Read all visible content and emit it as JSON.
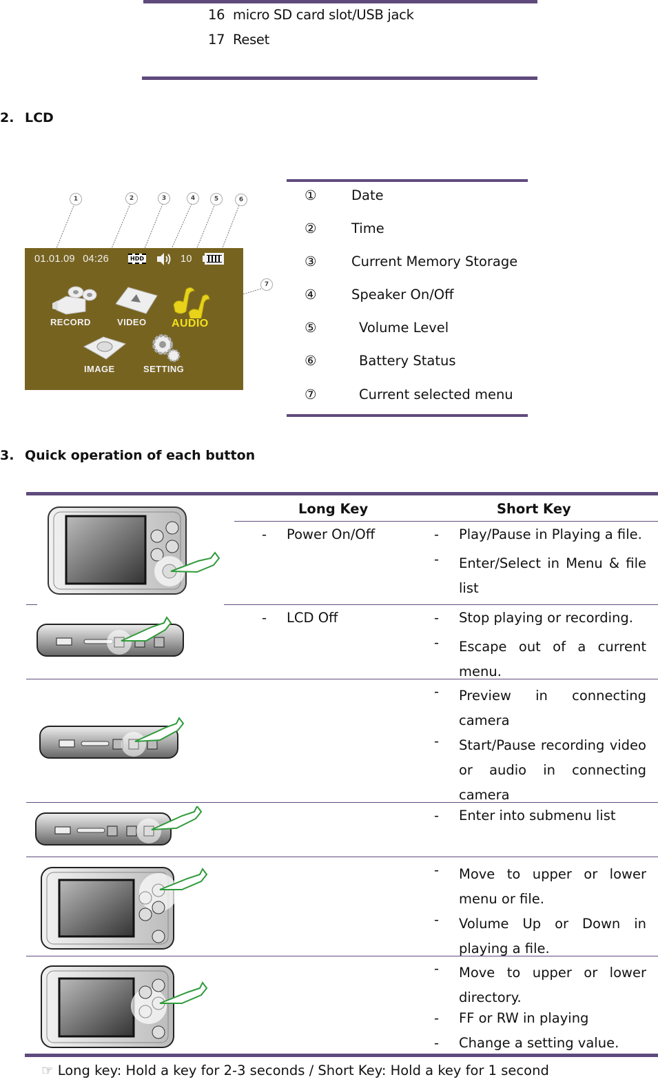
{
  "parts_table": {
    "rows": [
      {
        "number": "16",
        "label": "micro SD card slot/USB jack"
      },
      {
        "number": "17",
        "label": "Reset"
      }
    ]
  },
  "section_lcd": {
    "number": "2.",
    "title": "LCD",
    "lcd_screen": {
      "date": "01.01.09",
      "time": "04:26",
      "storage_icon": "hdd-icon",
      "storage_label": "HDD",
      "speaker_icon": "speaker-icon",
      "volume": "10",
      "battery_icon": "battery-icon",
      "menu_items": [
        {
          "label": "RECORD",
          "icon": "video-camera-icon",
          "selected": false
        },
        {
          "label": "VIDEO",
          "icon": "film-icon",
          "selected": false
        },
        {
          "label": "AUDIO",
          "icon": "music-note-icon",
          "selected": true
        },
        {
          "label": "IMAGE",
          "icon": "camera-icon",
          "selected": false
        },
        {
          "label": "SETTING",
          "icon": "gear-icon",
          "selected": false
        }
      ],
      "callouts": [
        "1",
        "2",
        "3",
        "4",
        "5",
        "6",
        "7"
      ]
    },
    "legend": [
      {
        "marker": "①",
        "label": "Date"
      },
      {
        "marker": "②",
        "label": "Time"
      },
      {
        "marker": "③",
        "label": "Current Memory Storage"
      },
      {
        "marker": "④",
        "label": "Speaker On/Off"
      },
      {
        "marker": "⑤",
        "label": "Volume Level"
      },
      {
        "marker": "⑥",
        "label": "Battery Status"
      },
      {
        "marker": "⑦",
        "label": "Current selected menu"
      }
    ]
  },
  "section_buttons": {
    "number": "3.",
    "title": "Quick operation of each button",
    "columns": {
      "long_key": "Long Key",
      "short_key": "Short Key"
    },
    "bullet": "-",
    "rows": [
      {
        "image": "device-front-play-button",
        "long_key": [
          "Power On/Off"
        ],
        "short_key": [
          "Play/Pause in Playing a file.",
          "Enter/Select in Menu & file list"
        ]
      },
      {
        "image": "device-side-stop-button",
        "long_key": [
          "LCD Off"
        ],
        "short_key": [
          "Stop playing or recording.",
          "Escape out of a current menu."
        ]
      },
      {
        "image": "device-side-record-button",
        "long_key": [],
        "short_key": [
          "Preview in connecting camera",
          "Start/Pause recording video or audio in connecting camera"
        ]
      },
      {
        "image": "device-side-menu-button",
        "long_key": [],
        "short_key": [
          "Enter into submenu list"
        ]
      },
      {
        "image": "device-front-volume-buttons",
        "long_key": [],
        "short_key": [
          "Move to upper or lower menu or file.",
          "Volume Up or Down in playing a file."
        ]
      },
      {
        "image": "device-front-ff-rw-buttons",
        "long_key": [],
        "short_key": [
          "Move to upper or lower directory.",
          "FF or RW in playing",
          "Change a setting value."
        ]
      }
    ],
    "footnote_icon": "pointing-hand-icon",
    "footnote_glyph": "☞",
    "footnote": "Long key: Hold a key for 2-3 seconds / Short Key: Hold a key for 1 second"
  },
  "colors": {
    "rule": "#5f4a7c",
    "lcd_background": "#776320",
    "lcd_selected": "#f4e21a",
    "hand_outline": "#2f9a3a"
  }
}
